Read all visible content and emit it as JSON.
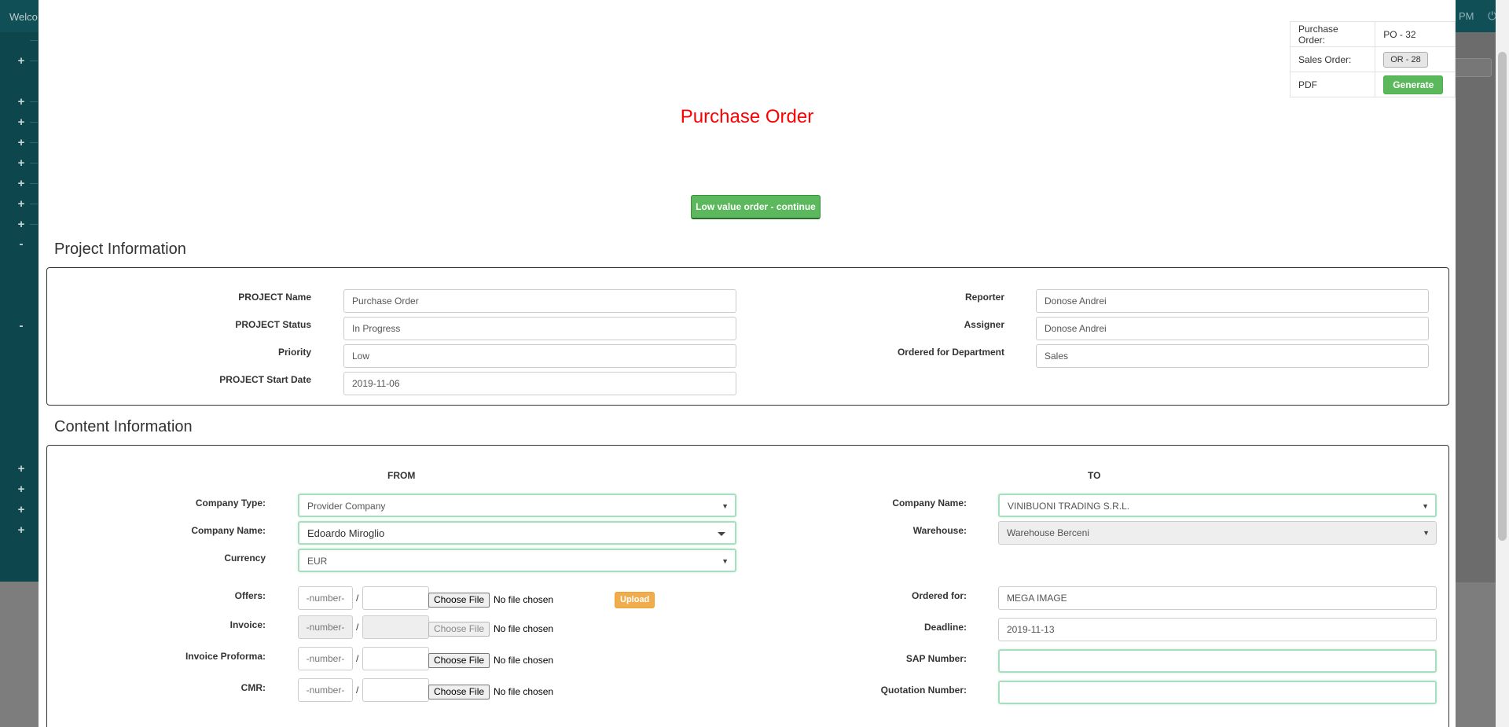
{
  "background": {
    "welcome": "Welco",
    "time": "PM",
    "sidebar_marks": [
      "+",
      "+",
      "+",
      "+",
      "+",
      "+",
      "+",
      "+",
      "-",
      "-",
      "+",
      "+",
      "+",
      "+"
    ]
  },
  "summary": {
    "purchase_order_label": "Purchase Order:",
    "purchase_order_value": "PO - 32",
    "sales_order_label": "Sales Order:",
    "sales_order_value": "OR - 28",
    "pdf_label": "PDF",
    "generate_label": "Generate"
  },
  "page_title": "Purchase Order",
  "low_value_button": "Low value order - continue",
  "project_info": {
    "title": "Project Information",
    "name_label": "PROJECT Name",
    "name_value": "Purchase Order",
    "status_label": "PROJECT Status",
    "status_value": "In Progress",
    "priority_label": "Priority",
    "priority_value": "Low",
    "start_label": "PROJECT Start Date",
    "start_value": "2019-11-06",
    "reporter_label": "Reporter",
    "reporter_value": "Donose Andrei",
    "assigner_label": "Assigner",
    "assigner_value": "Donose Andrei",
    "department_label": "Ordered for Department",
    "department_value": "Sales"
  },
  "content_info": {
    "title": "Content Information",
    "from_heading": "FROM",
    "to_heading": "TO",
    "company_type_label": "Company Type:",
    "company_type_value": "Provider Company",
    "from_company_label": "Company Name:",
    "from_company_value": "Edoardo Miroglio",
    "currency_label": "Currency",
    "currency_value": "EUR",
    "to_company_label": "Company Name:",
    "to_company_value": "VINIBUONI TRADING S.R.L.",
    "warehouse_label": "Warehouse:",
    "warehouse_value": "Warehouse Berceni",
    "docs": [
      {
        "label": "Offers:",
        "number_placeholder": "-number-",
        "slash": "/",
        "choose": "Choose File",
        "chosen": "No file chosen"
      },
      {
        "label": "Invoice:",
        "number_placeholder": "-number-",
        "slash": "/",
        "choose": "Choose File",
        "chosen": "No file chosen"
      },
      {
        "label": "Invoice Proforma:",
        "number_placeholder": "-number-",
        "slash": "/",
        "choose": "Choose File",
        "chosen": "No file chosen"
      },
      {
        "label": "CMR:",
        "number_placeholder": "-number-",
        "slash": "/",
        "choose": "Choose File",
        "chosen": "No file chosen"
      }
    ],
    "upload_label": "Upload",
    "ordered_for_label": "Ordered for:",
    "ordered_for_value": "MEGA IMAGE",
    "deadline_label": "Deadline:",
    "deadline_value": "2019-11-13",
    "sap_label": "SAP Number:",
    "sap_value": "",
    "quotation_label": "Quotation Number:",
    "quotation_value": ""
  },
  "colors": {
    "title_red": "#ff0000",
    "success_green": "#5cb85c",
    "warning_orange": "#f0ad4e",
    "sidebar_teal": "#0d474d"
  },
  "icons": [
    "power-icon",
    "dropdown-caret-icon",
    "plus-icon",
    "minus-icon"
  ]
}
